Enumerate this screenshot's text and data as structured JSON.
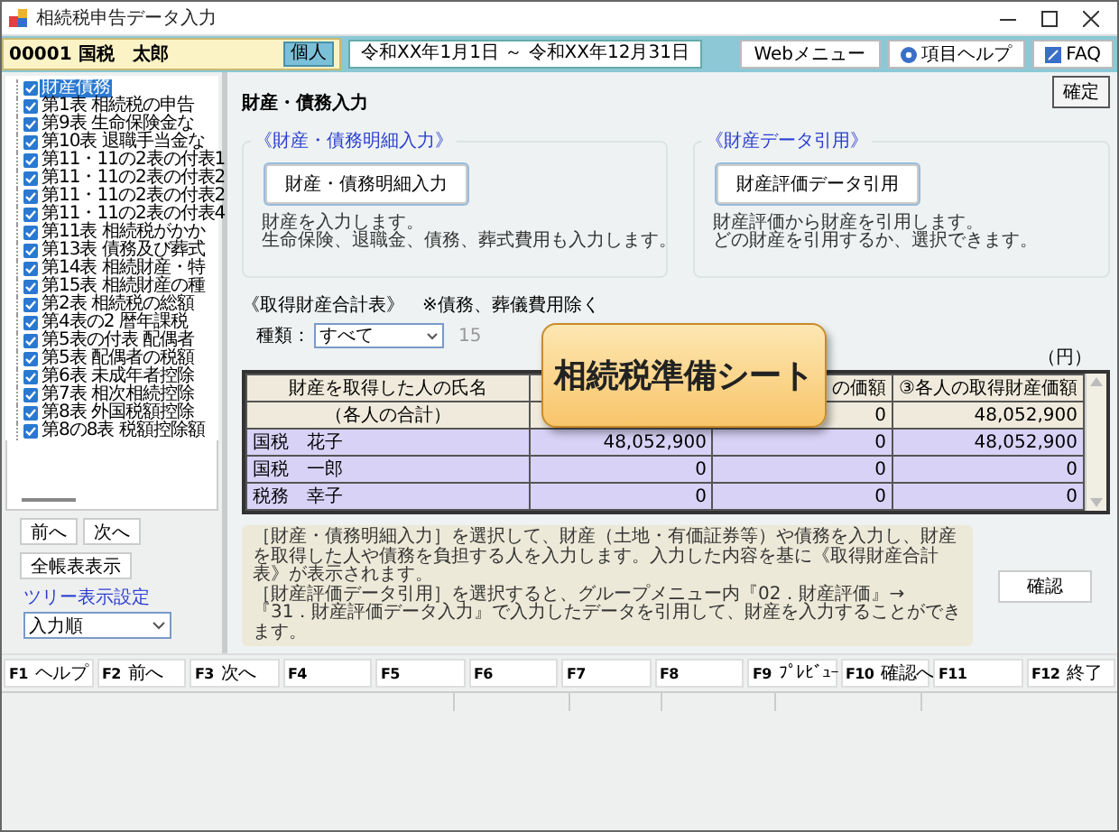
{
  "window": {
    "title": "相続税申告データ入力"
  },
  "header": {
    "taxpayer": "00001 国税　太郎",
    "badge": "個人",
    "period": "令和XX年1月1日 ～ 令和XX年12月31日",
    "buttons": [
      {
        "label": "Webメニュー"
      },
      {
        "label": "項目ヘルプ"
      },
      {
        "label": "FAQ"
      }
    ]
  },
  "tree": {
    "items": [
      {
        "label": "財産債務",
        "checked": true,
        "selected": true
      },
      {
        "label": "第1表 相続税の申告",
        "checked": true,
        "selected": false
      },
      {
        "label": "第9表 生命保険金な",
        "checked": true,
        "selected": false
      },
      {
        "label": "第10表 退職手当金な",
        "checked": true,
        "selected": false
      },
      {
        "label": "第11・11の2表の付表1",
        "checked": true,
        "selected": false
      },
      {
        "label": "第11・11の2表の付表2",
        "checked": true,
        "selected": false
      },
      {
        "label": "第11・11の2表の付表2",
        "checked": true,
        "selected": false
      },
      {
        "label": "第11・11の2表の付表4",
        "checked": true,
        "selected": false
      },
      {
        "label": "第11表 相続税がかか",
        "checked": true,
        "selected": false
      },
      {
        "label": "第13表 債務及び葬式",
        "checked": true,
        "selected": false
      },
      {
        "label": "第14表 相続財産・特",
        "checked": true,
        "selected": false
      },
      {
        "label": "第15表 相続財産の種",
        "checked": true,
        "selected": false
      },
      {
        "label": "第2表 相続税の総額",
        "checked": true,
        "selected": false
      },
      {
        "label": "第4表の2 暦年課税",
        "checked": true,
        "selected": false
      },
      {
        "label": "第5表の付表 配偶者",
        "checked": true,
        "selected": false
      },
      {
        "label": "第5表 配偶者の税額",
        "checked": true,
        "selected": false
      },
      {
        "label": "第6表 未成年者控除",
        "checked": true,
        "selected": false
      },
      {
        "label": "第7表 相次相続控除",
        "checked": true,
        "selected": false
      },
      {
        "label": "第8表 外国税額控除",
        "checked": true,
        "selected": false
      },
      {
        "label": "第8の8表 税額控除額",
        "checked": true,
        "selected": false
      }
    ]
  },
  "nav": {
    "prev": "前へ",
    "next": "次へ",
    "show_all": "全帳表表示",
    "tree_setting_label": "ツリー表示設定",
    "tree_order": "入力順"
  },
  "main": {
    "title": "財産・債務入力",
    "confirm_top": "確定",
    "groups": [
      {
        "legend": "《財産・債務明細入力》",
        "button": "財産・債務明細入力",
        "description": [
          "財産を入力します。",
          "生命保険、退職金、債務、葬式費用も入力します。"
        ]
      },
      {
        "legend": "《財産データ引用》",
        "button": "財産評価データ引用",
        "description": [
          "財産評価から財産を引用します。",
          "どの財産を引用するか、選択できます。"
        ]
      }
    ],
    "summary": {
      "title": "《取得財産合計表》",
      "note": "※債務、葬儀費用除く",
      "kind_label": "種類：",
      "kind_value": "すべて",
      "partial_text": "15",
      "unit": "（円）",
      "headings": {
        "column_1": "財産を取得した人の氏名",
        "column_3": "の価額",
        "column_4": "③各人の取得財産価額"
      },
      "rows": [
        {
          "kind": "total",
          "name": "（各人の合計）",
          "column_3": "0",
          "column_4": "48,052,900"
        },
        {
          "kind": "person",
          "name": "国税　花子",
          "column_2": "48,052,900",
          "column_3": "0",
          "column_4": "48,052,900"
        },
        {
          "kind": "person",
          "name": "国税　一郎",
          "column_2": "0",
          "column_3": "0",
          "column_4": "0"
        },
        {
          "kind": "person",
          "name": "税務　幸子",
          "column_2": "0",
          "column_3": "0",
          "column_4": "0"
        }
      ]
    },
    "callout": "相続税準備シート",
    "help_text": [
      "［財産・債務明細入力］を選択して、財産（土地・有価証券等）や債務を入力し、財産を取得した人や債務を負担する人を入力します。入力した内容を基に《取得財産合計表》が表示されます。",
      "［財産評価データ引用］を選択すると、グループメニュー内『02．財産評価』→『31．財産評価データ入力』で入力したデータを引用して、財産を入力することができます。"
    ],
    "confirm_button": "確認"
  },
  "function_keys": [
    {
      "key": "F1",
      "label": "ヘルプ"
    },
    {
      "key": "F2",
      "label": "前へ"
    },
    {
      "key": "F3",
      "label": "次へ"
    },
    {
      "key": "F4"
    },
    {
      "key": "F5"
    },
    {
      "key": "F6"
    },
    {
      "key": "F7"
    },
    {
      "key": "F8"
    },
    {
      "key": "F9",
      "label": "ﾌﾟﾚﾋﾞｭｰ"
    },
    {
      "key": "F10",
      "label": "確認へ"
    },
    {
      "key": "F11"
    },
    {
      "key": "F12",
      "label": "終了"
    }
  ]
}
